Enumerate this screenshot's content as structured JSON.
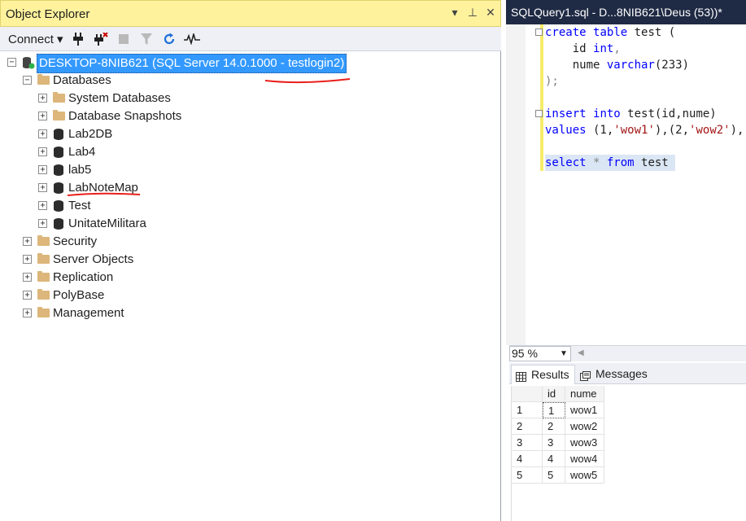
{
  "object_explorer": {
    "title": "Object Explorer",
    "controls": [
      "▾",
      "⊥",
      "✕"
    ],
    "toolbar": {
      "connect_label": "Connect",
      "icons": [
        "connect-plug-icon",
        "disconnect-icon",
        "stop-icon",
        "filter-icon",
        "refresh-icon",
        "activity-monitor-icon"
      ]
    },
    "server": "DESKTOP-8NIB621 (SQL Server 14.0.1000 - testlogin2)",
    "databases_label": "Databases",
    "database_children": [
      "System Databases",
      "Database Snapshots",
      "Lab2DB",
      "Lab4",
      "lab5",
      "LabNoteMap",
      "Test",
      "UnitateMilitara"
    ],
    "server_children": [
      "Security",
      "Server Objects",
      "Replication",
      "PolyBase",
      "Management"
    ]
  },
  "query_editor": {
    "tab_title": "SQLQuery1.sql - D...8NIB621\\Deus (53))*",
    "zoom": "95 %",
    "code": {
      "l1_kw1": "create",
      "l1_kw2": "table",
      "l1_rest": " test (",
      "l2_id": "    id ",
      "l2_type": "int",
      "l2_comma": ",",
      "l3_name": "    nume ",
      "l3_type": "varchar",
      "l3_arg": "(233)",
      "l4": ");",
      "l6_kw1": "insert",
      "l6_kw2": "into",
      "l6_rest": " test(id,nume)",
      "l7_kw": "values",
      "l7_p1": " (1,",
      "l7_s1": "'wow1'",
      "l7_p2": "),(2,",
      "l7_s2": "'wow2'",
      "l7_p3": "),",
      "l9_kw1": "select",
      "l9_star": " * ",
      "l9_kw2": "from",
      "l9_rest": " test"
    },
    "results_tab": "Results",
    "messages_tab": "Messages",
    "grid": {
      "columns": [
        "id",
        "nume"
      ],
      "rows": [
        {
          "n": "1",
          "id": "1",
          "nume": "wow1"
        },
        {
          "n": "2",
          "id": "2",
          "nume": "wow2"
        },
        {
          "n": "3",
          "id": "3",
          "nume": "wow3"
        },
        {
          "n": "4",
          "id": "4",
          "nume": "wow4"
        },
        {
          "n": "5",
          "id": "5",
          "nume": "wow5"
        }
      ]
    }
  }
}
